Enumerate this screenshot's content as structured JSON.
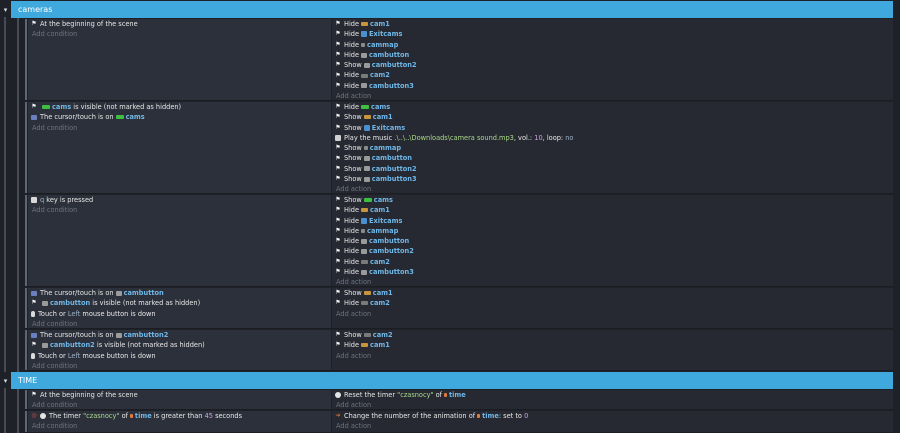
{
  "groups": {
    "cameras": {
      "title": "cameras",
      "arrow": "▾"
    },
    "time": {
      "title": "TIME",
      "arrow": "▾"
    }
  },
  "common": {
    "add_condition": "Add condition",
    "add_action": "Add action"
  },
  "colors": {
    "accent": "#3fa9de",
    "object": "#6fb7e8",
    "string": "#a9d98c"
  },
  "events": {
    "e1": {
      "conditions": {
        "c1": {
          "text": "At the beginning of the scene"
        }
      },
      "actions": {
        "a1": {
          "verb": "Hide",
          "object": "cam1"
        },
        "a2": {
          "verb": "Hide",
          "object": "Exitcams"
        },
        "a3": {
          "verb": "Hide",
          "object": "cammap"
        },
        "a4": {
          "verb": "Hide",
          "object": "cambutton"
        },
        "a5": {
          "verb": "Show",
          "object": "cambutton2"
        },
        "a6": {
          "verb": "Hide",
          "object": "cam2"
        },
        "a7": {
          "verb": "Hide",
          "object": "cambutton3"
        }
      }
    },
    "e2": {
      "conditions": {
        "c1": {
          "object": "cams",
          "text": "is visible (not marked as hidden)"
        },
        "c2": {
          "text": "The cursor/touch is on",
          "object": "cams"
        }
      },
      "actions": {
        "a1": {
          "verb": "Hide",
          "object": "cams"
        },
        "a2": {
          "verb": "Show",
          "object": "cam1"
        },
        "a3": {
          "verb": "Show",
          "object": "Exitcams"
        },
        "a4": {
          "text": "Play the music",
          "file": ".\\..\\..\\Downloads\\camera sound.mp3",
          "vol_label": ", vol.:",
          "vol": "10",
          "loop_label": ", loop:",
          "loop": "no"
        },
        "a5": {
          "verb": "Show",
          "object": "cammap"
        },
        "a6": {
          "verb": "Show",
          "object": "cambutton"
        },
        "a7": {
          "verb": "Show",
          "object": "cambutton2"
        },
        "a8": {
          "verb": "Show",
          "object": "cambutton3"
        }
      }
    },
    "e3": {
      "conditions": {
        "c1": {
          "key": "q",
          "text": "key is pressed"
        }
      },
      "actions": {
        "a1": {
          "verb": "Show",
          "object": "cams"
        },
        "a2": {
          "verb": "Hide",
          "object": "cam1"
        },
        "a3": {
          "verb": "Hide",
          "object": "Exitcams"
        },
        "a4": {
          "verb": "Hide",
          "object": "cammap"
        },
        "a5": {
          "verb": "Hide",
          "object": "cambutton"
        },
        "a6": {
          "verb": "Hide",
          "object": "cambutton2"
        },
        "a7": {
          "verb": "Hide",
          "object": "cam2"
        },
        "a8": {
          "verb": "Hide",
          "object": "cambutton3"
        }
      }
    },
    "e4": {
      "conditions": {
        "c1": {
          "text": "The cursor/touch is on",
          "object": "cambutton"
        },
        "c2": {
          "object": "cambutton",
          "text": "is visible (not marked as hidden)"
        },
        "c3": {
          "pre": "Touch or",
          "button": "Left",
          "post": "mouse button is down"
        }
      },
      "actions": {
        "a1": {
          "verb": "Show",
          "object": "cam1"
        },
        "a2": {
          "verb": "Hide",
          "object": "cam2"
        }
      }
    },
    "e5": {
      "conditions": {
        "c1": {
          "text": "The cursor/touch is on",
          "object": "cambutton2"
        },
        "c2": {
          "object": "cambutton2",
          "text": "is visible (not marked as hidden)"
        },
        "c3": {
          "pre": "Touch or",
          "button": "Left",
          "post": "mouse button is down"
        }
      },
      "actions": {
        "a1": {
          "verb": "Show",
          "object": "cam2"
        },
        "a2": {
          "verb": "Hide",
          "object": "cam1"
        }
      }
    },
    "e6": {
      "conditions": {
        "c1": {
          "text": "At the beginning of the scene"
        }
      },
      "actions": {
        "a1": {
          "pre": "Reset the timer",
          "timer": "\"czasnocy\"",
          "of": "of",
          "object": "time"
        }
      }
    },
    "e7": {
      "conditions": {
        "c1": {
          "pre": "The timer",
          "timer": "\"czasnocy\"",
          "of": "of",
          "object": "time",
          "mid": "is greater than",
          "value": "45",
          "post": "seconds"
        }
      },
      "actions": {
        "a1": {
          "pre": "Change the number of the animation of",
          "object": "time",
          "post": ": set to",
          "value": "0"
        }
      }
    }
  }
}
